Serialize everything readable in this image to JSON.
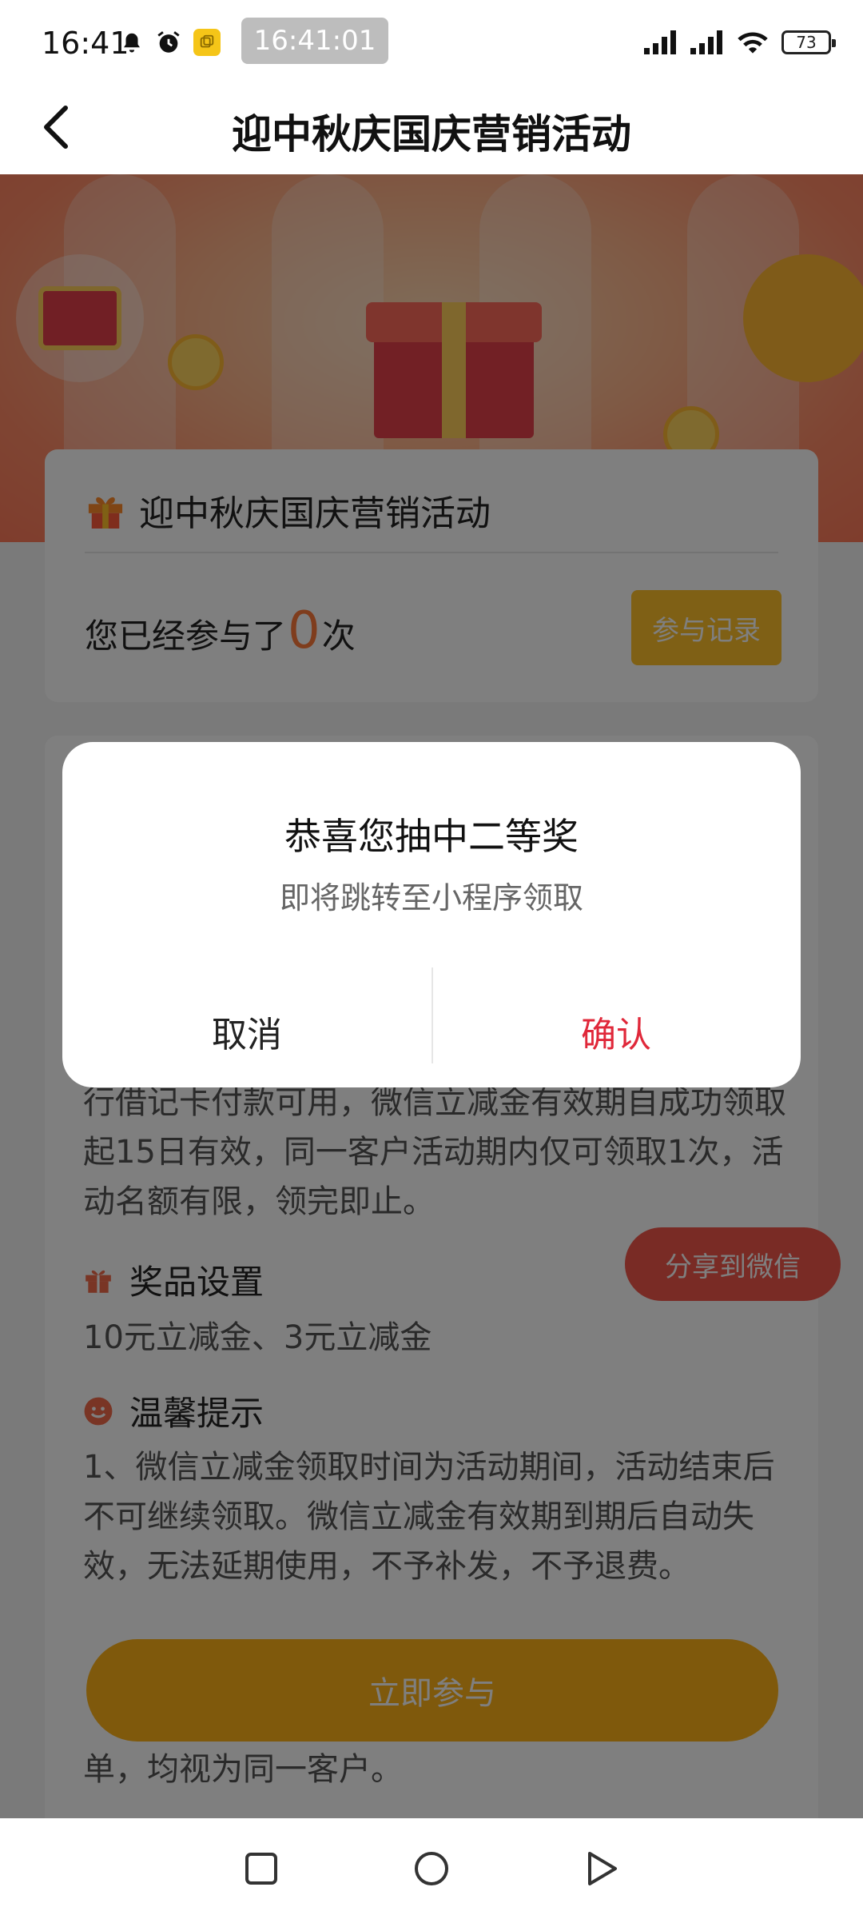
{
  "status_bar": {
    "time": "16:41",
    "clock_chip": "16:41:01",
    "battery": "73",
    "icons": [
      "bell-icon",
      "alarm-icon",
      "app-notification-icon",
      "signal-icon",
      "signal-icon",
      "wifi-icon",
      "battery-icon"
    ]
  },
  "header": {
    "title": "迎中秋庆国庆营销活动",
    "back_icon": "chevron-left-icon"
  },
  "activity_card": {
    "title": "迎中秋庆国庆营销活动",
    "participated_prefix": "您已经参与了",
    "participated_count": "0",
    "participated_suffix": "次",
    "record_button": "参与记录"
  },
  "details": {
    "intro_text": "行借记卡付款可用，微信立减金有效期自成功领取起15日有效，同一客户活动期内仅可领取1次，活动名额有限，领完即止。",
    "prize_heading": "奖品设置",
    "prize_text": "10元立减金、3元立减金",
    "tips_heading": "温馨提示",
    "tips_text_1": "1、微信立减金领取时间为活动期间，活动结束后不可继续领取。微信立减金有效期到期后自动失效，无法延期使用，不予补发，不予退费。",
    "tips_text_2": "单，均视为同一客户。",
    "share_button": "分享到微信",
    "join_button": "立即参与"
  },
  "dialog": {
    "title": "恭喜您抽中二等奖",
    "message": "即将跳转至小程序领取",
    "cancel": "取消",
    "confirm": "确认"
  },
  "nav_bar": {
    "buttons": [
      "square-recents-icon",
      "circle-home-icon",
      "triangle-back-icon"
    ]
  },
  "colors": {
    "accent_orange": "#ffb319",
    "confirm_red": "#e0283a",
    "share_red": "#f2574a"
  }
}
